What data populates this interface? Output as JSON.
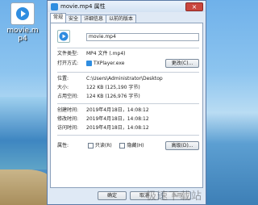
{
  "desktop": {
    "icon_label": "movie.m\np4",
    "icon_name": "video-file-icon"
  },
  "dialog": {
    "title": "movie.mp4 属性",
    "close_glyph": "×",
    "tabs": [
      "常规",
      "安全",
      "详细信息",
      "以前的版本"
    ],
    "filename": "movie.mp4",
    "rows": {
      "type_label": "文件类型:",
      "type_value": "MP4 文件 (.mp4)",
      "open_label": "打开方式:",
      "open_value": "TXPlayer.exe",
      "change_button": "更改(C)...",
      "location_label": "位置:",
      "location_value": "C:\\Users\\Administrator\\Desktop",
      "size_label": "大小:",
      "size_value": "122 KB (125,190 字节)",
      "disk_label": "占用空间:",
      "disk_value": "124 KB (126,976 字节)",
      "created_label": "创建时间:",
      "created_value": "2019年4月18日，14:08:12",
      "modified_label": "修改时间:",
      "modified_value": "2019年4月18日，14:08:12",
      "accessed_label": "访问时间:",
      "accessed_value": "2019年4月18日，14:08:12",
      "attr_label": "属性:",
      "readonly_label": "只读(R)",
      "hidden_label": "隐藏(H)",
      "advanced_button": "高级(D)..."
    },
    "footer": {
      "ok": "确定",
      "cancel": "取消",
      "apply": "应用"
    },
    "watermark": "极速下载站"
  },
  "colors": {
    "accent": "#2f8de0",
    "close": "#c9463d"
  }
}
